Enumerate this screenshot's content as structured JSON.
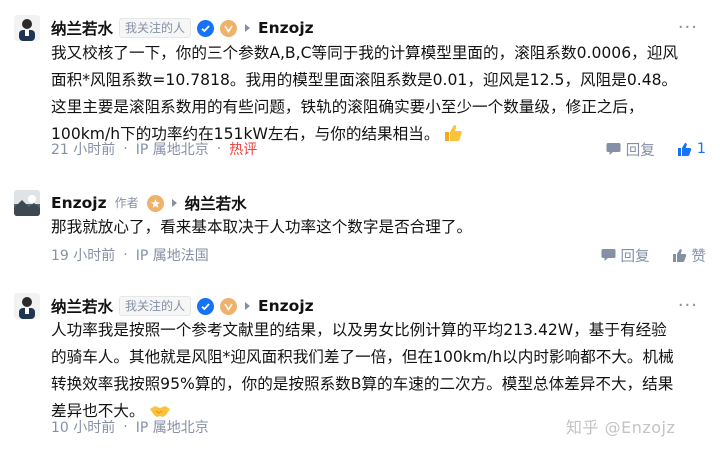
{
  "comments": [
    {
      "author": "纳兰若水",
      "relation_tag": "我关注的人",
      "reply_to": "Enzojz",
      "lines": [
        "我又校核了一下，你的三个参数A,B,C等同于我的计算模型里面的，滚阻系数0.0006，迎风",
        "面积*风阻系数=10.7818。我用的模型里面滚阻系数是0.01，迎风是12.5，风阻是0.48。",
        "这里主要是滚阻系数用的有些问题，铁轨的滚阻确实要小至少一个数量级，修正之后，",
        "100km/h下的功率约在151kW左右，与你的结果相当。"
      ],
      "emoji": "thumbs-up-emoji",
      "time": "21 小时前",
      "ip": "IP 属地北京",
      "hot_label": "热评",
      "reply_label": "回复",
      "like_count": "1"
    },
    {
      "author": "Enzojz",
      "relation_tag": "作者",
      "reply_to": "纳兰若水",
      "lines": [
        "那我就放心了，看来基本取决于人功率这个数字是否合理了。"
      ],
      "time": "19 小时前",
      "ip": "IP 属地法国",
      "reply_label": "回复",
      "like_label": "赞"
    },
    {
      "author": "纳兰若水",
      "relation_tag": "我关注的人",
      "reply_to": "Enzojz",
      "lines": [
        "人功率我是按照一个参考文献里的结果，以及男女比例计算的平均213.42W，基于有经验",
        "的骑车人。其他就是风阻*迎风面积我们差了一倍，但在100km/h以内时影响都不大。机械",
        "转换效率我按照95%算的，你的是按照系数B算的车速的二次方。模型总体差异不大，结果",
        "差异也不大。"
      ],
      "emoji": "handshake-emoji",
      "time": "10 小时前",
      "ip": "IP 属地北京"
    }
  ],
  "watermark": "知乎 @Enzojz",
  "colors": {
    "accent": "#1772f6",
    "muted": "#8590a6",
    "hot": "#f1403c"
  }
}
